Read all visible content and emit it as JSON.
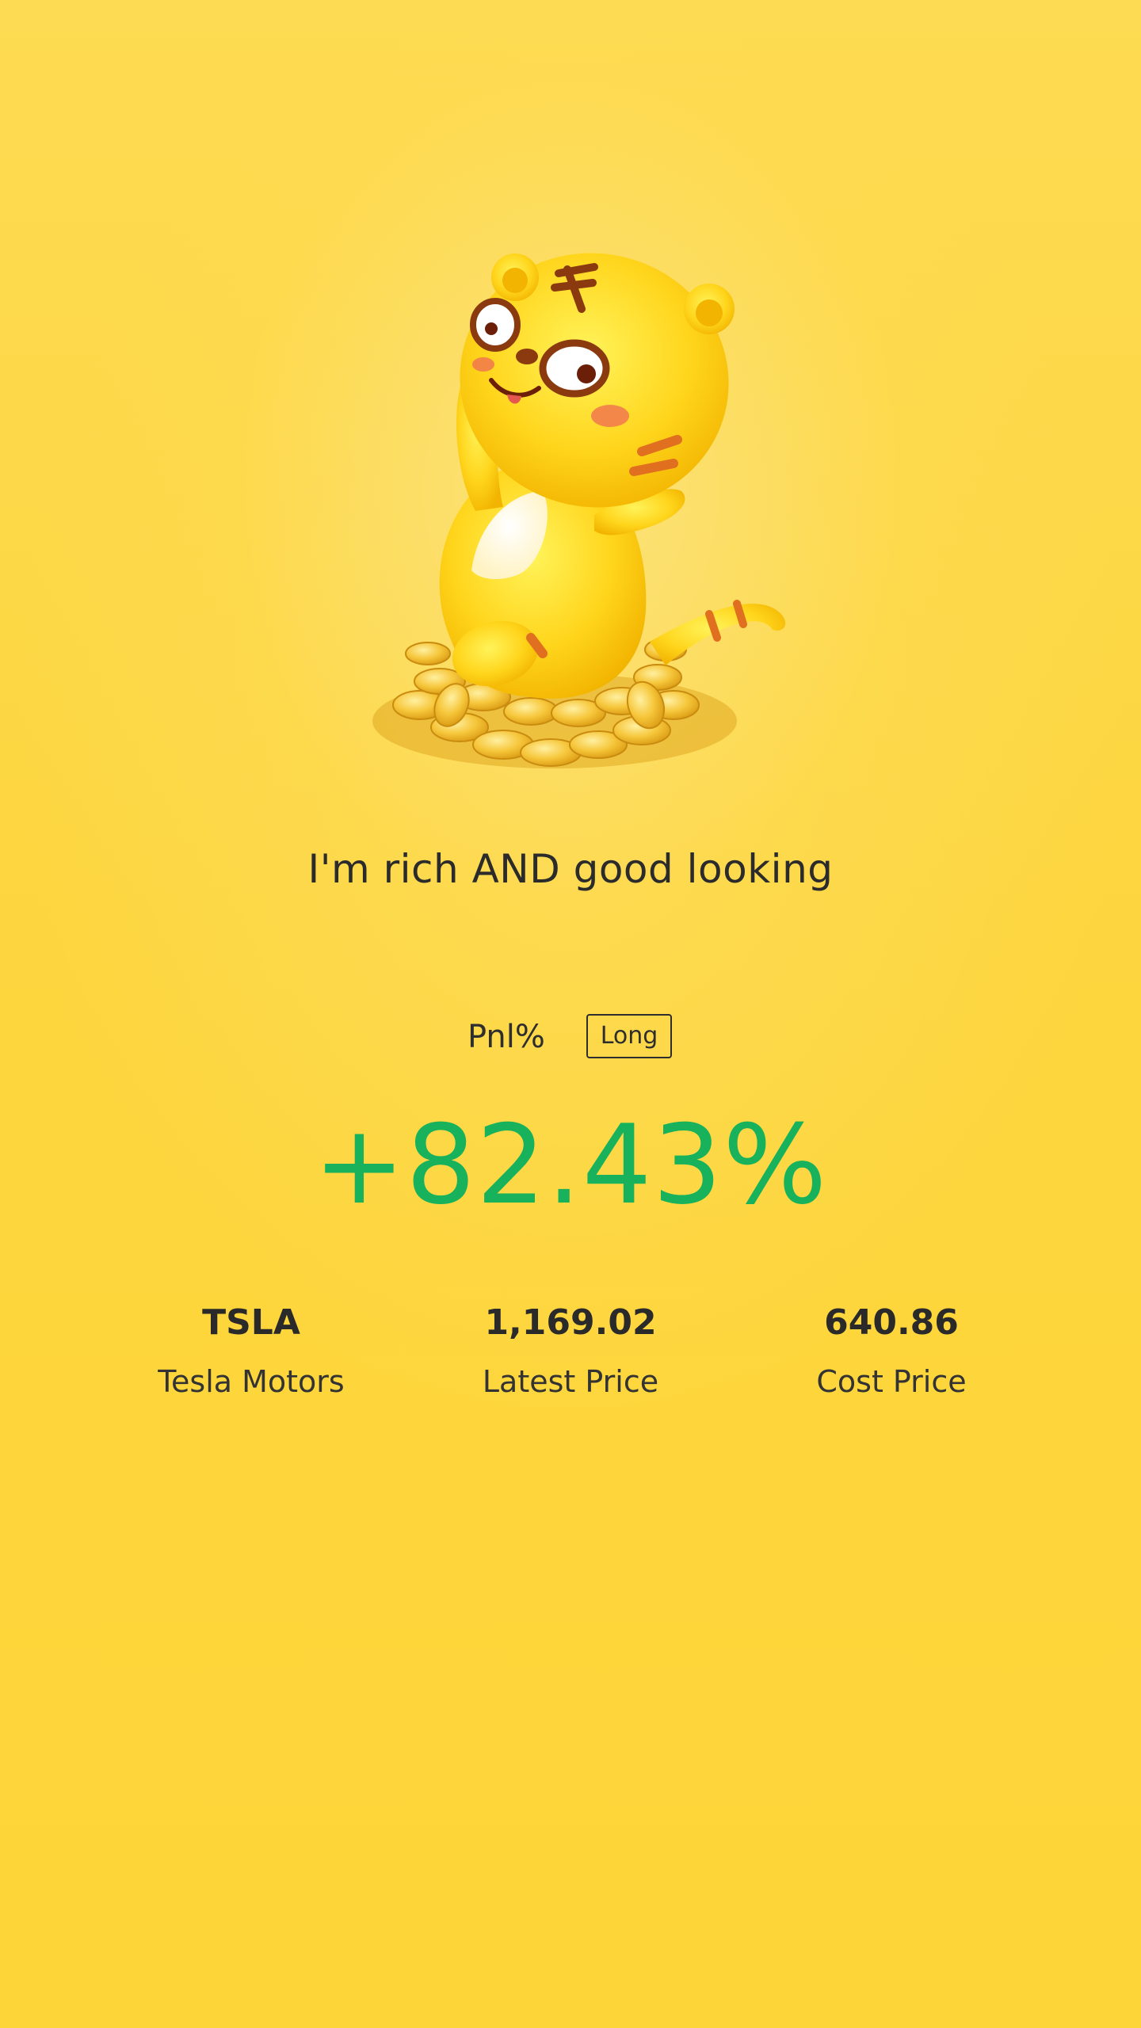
{
  "tagline": "I'm rich AND good looking",
  "pnl": {
    "label": "Pnl%",
    "side_badge": "Long",
    "value": "+82.43%",
    "value_color": "#17B25B"
  },
  "stats": [
    {
      "value": "TSLA",
      "label": "Tesla Motors"
    },
    {
      "value": "1,169.02",
      "label": "Latest Price"
    },
    {
      "value": "640.86",
      "label": "Cost Price"
    }
  ],
  "background_color": "#FDD43A",
  "illustration": "tiger-mascot-on-gold-coins-icon"
}
